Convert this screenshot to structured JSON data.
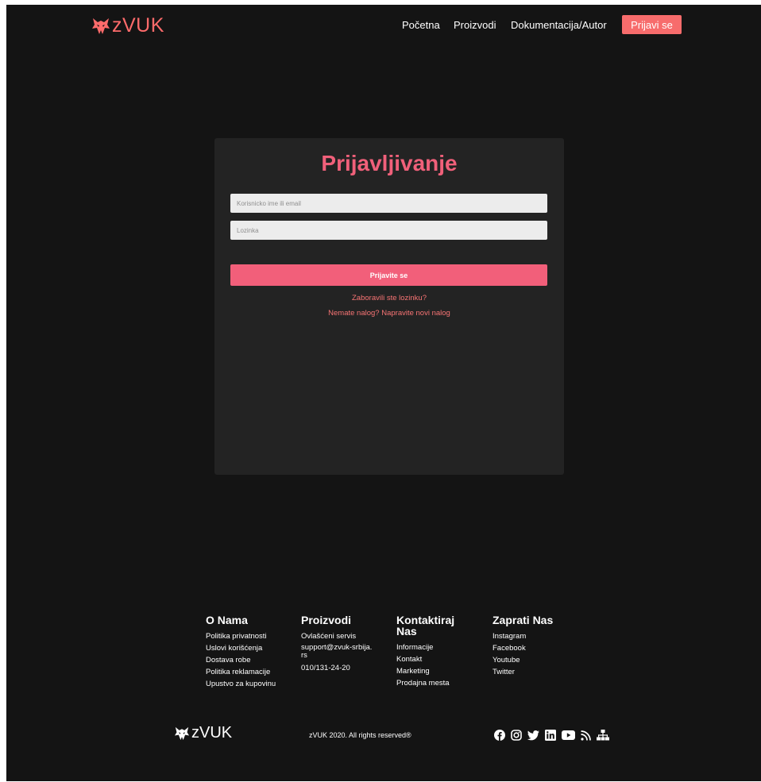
{
  "brand": {
    "logo_text": "zVUK",
    "accent": "#ff6b6b"
  },
  "nav": {
    "links": [
      "Početna",
      "Proizvodi",
      "Dokumentacija/Autor"
    ],
    "login_button": "Prijavi se"
  },
  "login": {
    "title": "Prijavljivanje",
    "username_placeholder": "Korisnicko ime ili email",
    "password_placeholder": "Lozinka",
    "submit_label": "Prijavite se",
    "forgot_link": "Zaboravili ste lozinku?",
    "register_link": "Nemate nalog? Napravite novi nalog"
  },
  "footer": {
    "columns": [
      {
        "title": "O Nama",
        "items": [
          "Politika privatnosti",
          "Uslovi korišćenja",
          "Dostava robe",
          "Politika reklamacije",
          "Upustvo za kupovinu"
        ]
      },
      {
        "title": "Proizvodi",
        "items": [
          "Ovlašćeni servis",
          "support@zvuk-srbija.rs",
          "010/131-24-20"
        ]
      },
      {
        "title": "Kontaktiraj Nas",
        "items": [
          "Informacije",
          "Kontakt",
          "Marketing",
          "Prodajna mesta"
        ]
      },
      {
        "title": "Zaprati Nas",
        "items": [
          "Instagram",
          "Facebook",
          "Youtube",
          "Twitter"
        ]
      }
    ],
    "logo_text": "zVUK",
    "copyright": "zVUK 2020. All rights reserved®",
    "social_icons": [
      "facebook-icon",
      "instagram-icon",
      "twitter-icon",
      "linkedin-icon",
      "youtube-icon",
      "rss-icon",
      "sitemap-icon"
    ]
  }
}
